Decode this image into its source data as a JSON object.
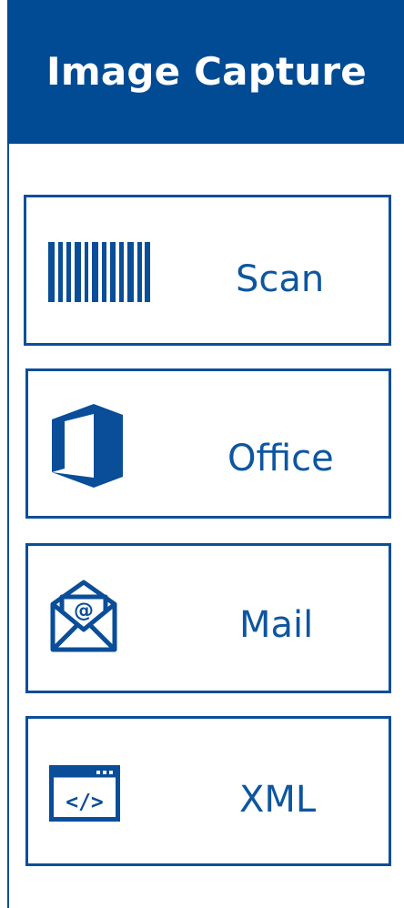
{
  "header": {
    "title": "Image Capture"
  },
  "tiles": [
    {
      "label": "Scan",
      "icon": "barcode-icon"
    },
    {
      "label": "Office",
      "icon": "office-icon"
    },
    {
      "label": "Mail",
      "icon": "mail-icon"
    },
    {
      "label": "XML",
      "icon": "xml-icon"
    }
  ],
  "colors": {
    "header_background": "#004b93",
    "header_text": "#ffffff",
    "tile_border": "#0b4f99",
    "tile_text": "#0d56a0",
    "icon": "#0a4d98"
  }
}
